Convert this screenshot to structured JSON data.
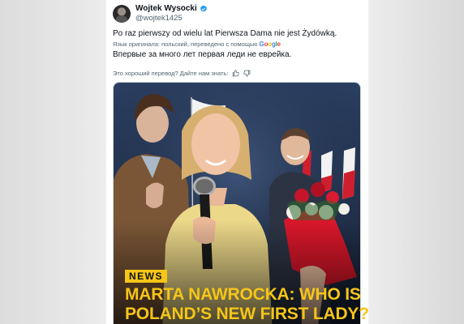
{
  "author": {
    "display_name": "Wojtek Wysocki",
    "handle": "@wojtek1425",
    "verified_icon": "verified-badge-icon",
    "verified_color": "#1d9bf0"
  },
  "tweet": {
    "original_text": "Po raz pierwszy od wielu lat Pierwsza Dama nie jest Żydówką.",
    "translation_meta": "Язык оригинала: польский, переведено с помощью",
    "translation_provider": "Google",
    "translated_text": "Впервые за много лет первая леди не еврейка.",
    "feedback_prompt": "Это хороший перевод? Дайте нам знать:",
    "thumbs_up_icon": "thumbs-up-icon",
    "thumbs_down_icon": "thumbs-down-icon"
  },
  "media": {
    "badge": "NEWS",
    "headline_line1": "MARTA NAWROCKA: WHO IS",
    "headline_line2": "POLAND’S NEW FIRST LADY?",
    "badge_color": "#f5c518",
    "headline_color": "#f5c518"
  }
}
